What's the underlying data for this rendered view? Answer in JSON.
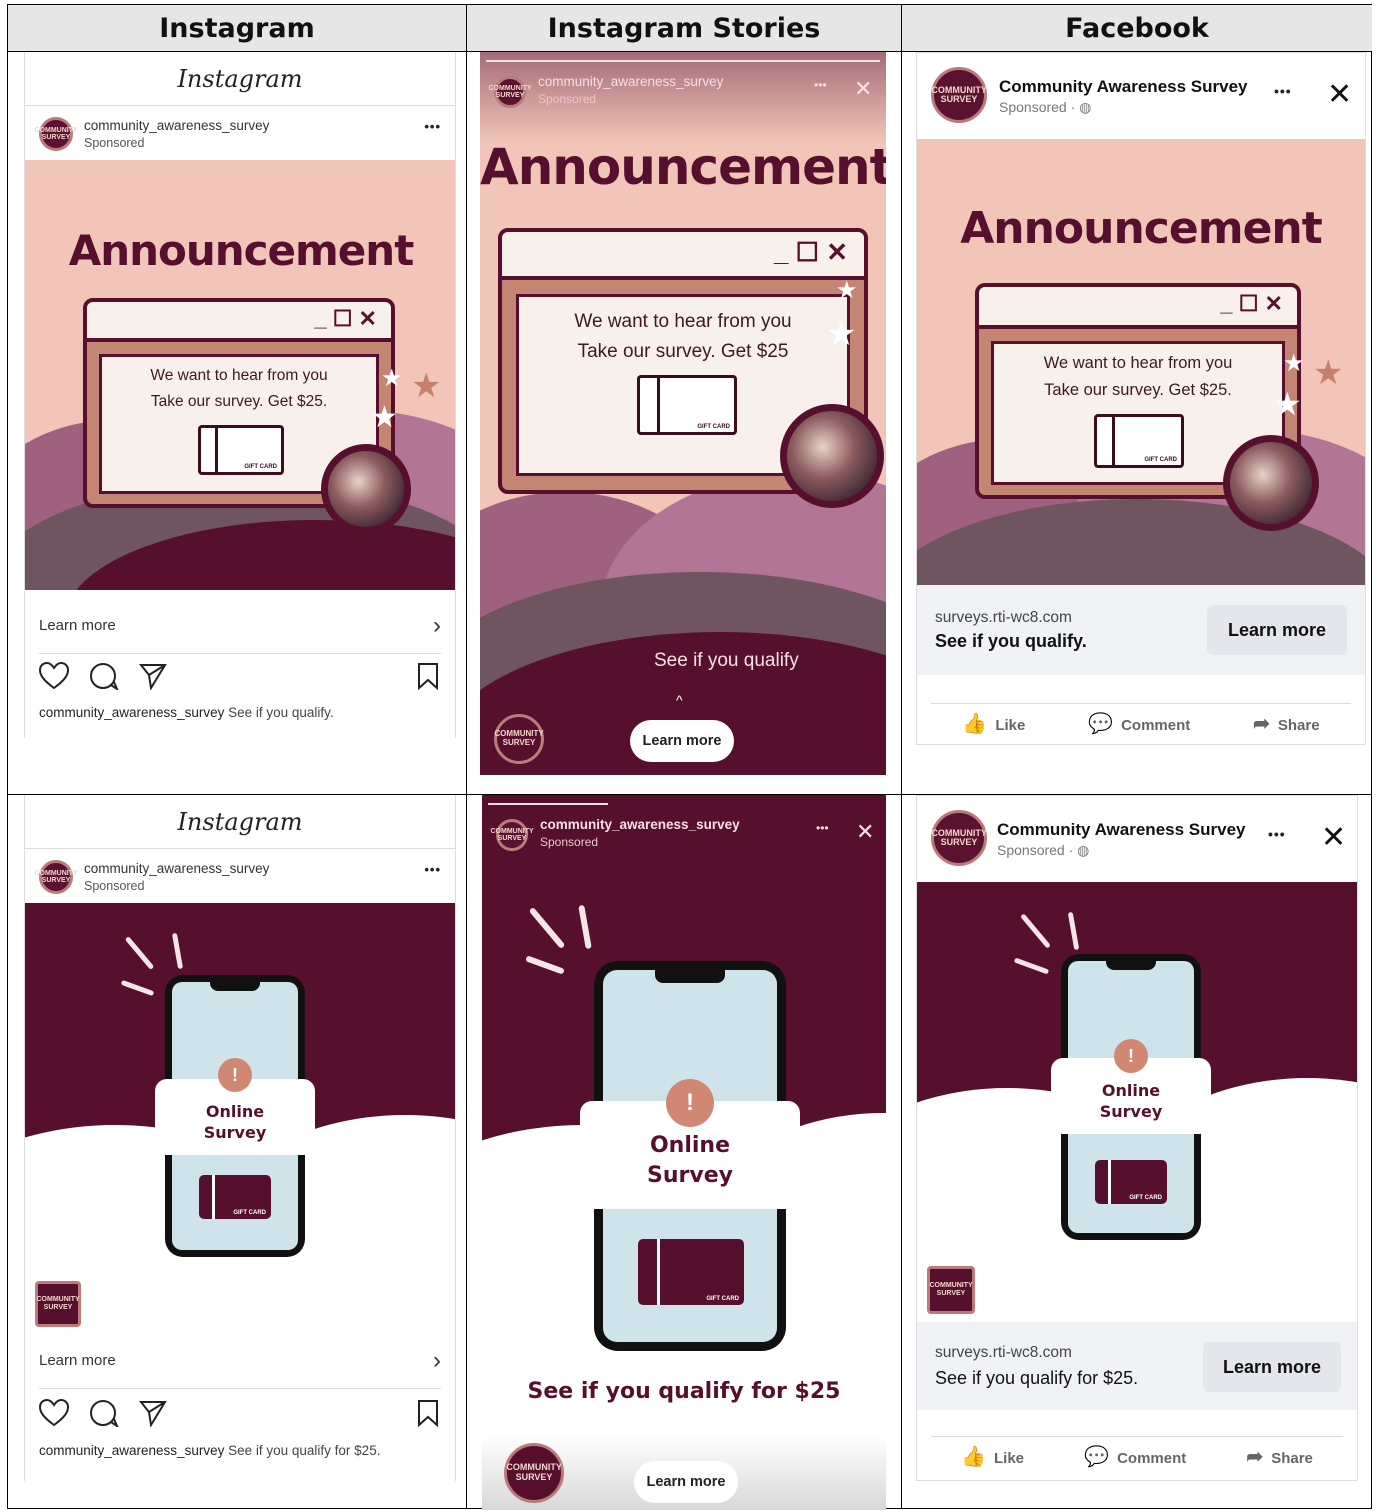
{
  "headers": [
    "Instagram",
    "Instagram Stories",
    "Facebook"
  ],
  "account": {
    "username": "community_awareness_survey",
    "sponsored": "Sponsored",
    "fb_name": "Community Awareness Survey",
    "fb_sponsored": "Sponsored · ",
    "logo_text": "COMMUNITY SURVEY"
  },
  "ig": {
    "brand": "Instagram",
    "learn_more": "Learn more",
    "chevron": "›",
    "more": "•••"
  },
  "row1": {
    "headline": "Announcement",
    "line1": "We want to hear from you",
    "line2_ig": "Take our survey. Get $25.",
    "line2_story": "Take our survey. Get $25",
    "line2_fb": "Take our survey. Get $25.",
    "window_controls": "_ ☐ ✕",
    "story_cta": "See if you qualify",
    "caption_ig": "See if you qualify.",
    "fb_url": "surveys.rti-wc8.com",
    "fb_q": "See if you qualify."
  },
  "row2": {
    "card_line1": "Online",
    "card_line2": "Survey",
    "warn": "!",
    "story_cta": "See if you qualify for $25",
    "caption_ig": "See if you qualify for $25.",
    "fb_url": "surveys.rti-wc8.com",
    "fb_q": "See if you qualify for $25."
  },
  "fb": {
    "learn_more": "Learn more",
    "like": "Like",
    "comment": "Comment",
    "share": "Share",
    "more": "•••",
    "close": "✕"
  },
  "stories": {
    "learn_more": "Learn more",
    "close": "✕",
    "more": "•••",
    "swipe": "^"
  }
}
